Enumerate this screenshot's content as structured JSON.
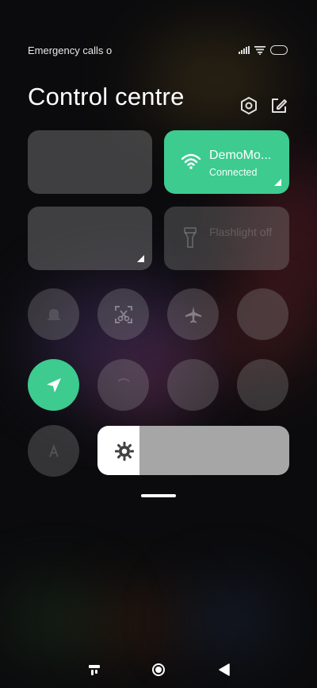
{
  "status_bar": {
    "carrier_text": "Emergency calls o",
    "icons": [
      "signal-icon",
      "wifi-icon",
      "battery-icon"
    ]
  },
  "header": {
    "title": "Control centre",
    "icons": [
      "settings-icon",
      "edit-icon"
    ]
  },
  "tiles": {
    "wifi": {
      "name": "DemoMo...",
      "status": "Connected",
      "color": "#3dcb8f"
    },
    "flashlight": {
      "label": "Flashlight off"
    }
  },
  "toggles": {
    "row1": [
      "bell-icon",
      "screenshot-icon",
      "airplane-icon",
      "toggle-icon"
    ],
    "row2": [
      "location-icon",
      "toggle-icon",
      "toggle-icon",
      "toggle-icon"
    ],
    "active_color": "#3dcb8f"
  },
  "brightness": {
    "level_percent": 22
  },
  "nav": [
    "recents-button",
    "home-button",
    "back-button"
  ]
}
